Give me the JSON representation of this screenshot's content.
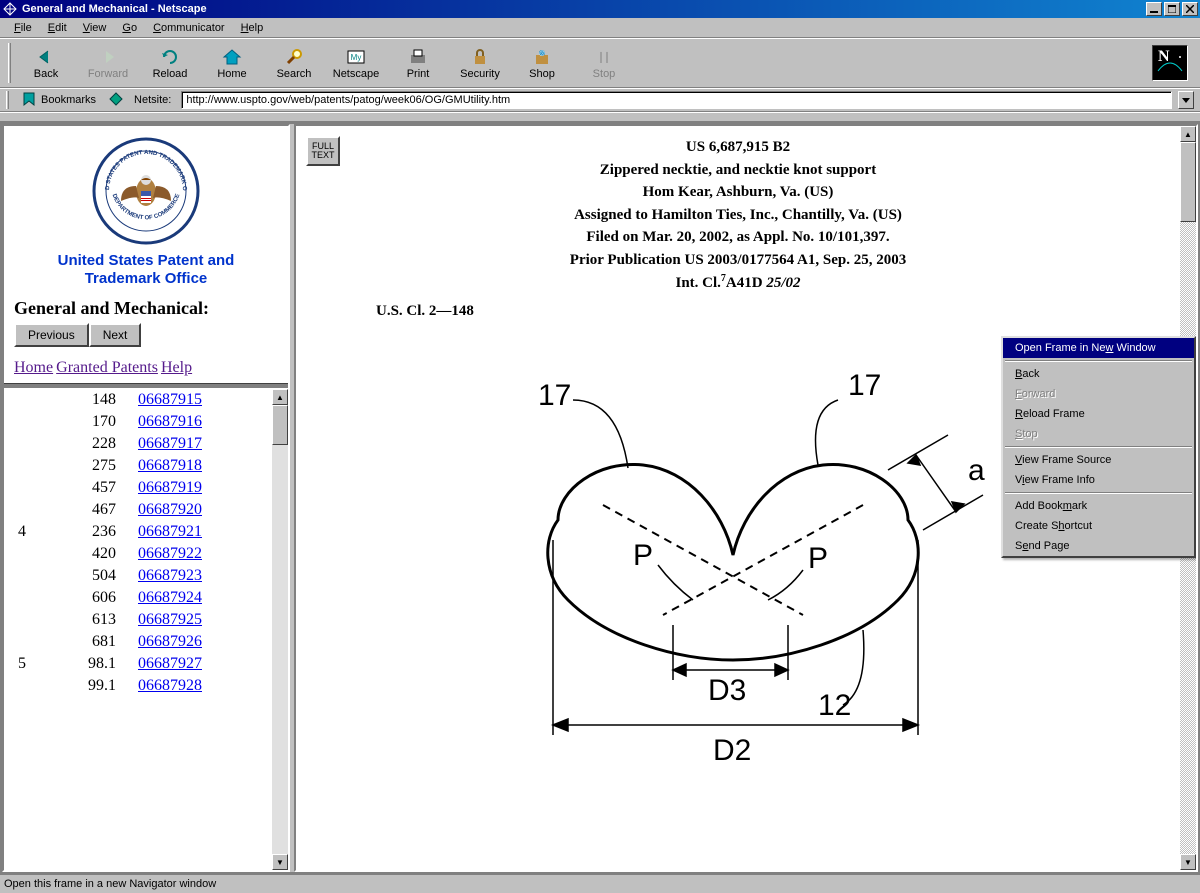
{
  "window": {
    "title": "General and Mechanical - Netscape"
  },
  "menus": {
    "file": "File",
    "edit": "Edit",
    "view": "View",
    "go": "Go",
    "communicator": "Communicator",
    "help": "Help"
  },
  "toolbar": {
    "back": "Back",
    "forward": "Forward",
    "reload": "Reload",
    "home": "Home",
    "search": "Search",
    "netscape": "Netscape",
    "print": "Print",
    "security": "Security",
    "shop": "Shop",
    "stop": "Stop"
  },
  "location": {
    "bookmarks": "Bookmarks",
    "netsite_label": "Netsite:",
    "url": "http://www.uspto.gov/web/patents/patog/week06/OG/GMUtility.htm"
  },
  "left": {
    "office_line1": "United States Patent and",
    "office_line2": "Trademark Office",
    "section_title": "General and Mechanical:",
    "prev": "Previous",
    "next": "Next",
    "links": {
      "home": "Home",
      "granted": "Granted Patents",
      "help": "Help"
    },
    "rows": [
      {
        "c1": "",
        "c2": "148",
        "c3": "06687915"
      },
      {
        "c1": "",
        "c2": "170",
        "c3": "06687916"
      },
      {
        "c1": "",
        "c2": "228",
        "c3": "06687917"
      },
      {
        "c1": "",
        "c2": "275",
        "c3": "06687918"
      },
      {
        "c1": "",
        "c2": "457",
        "c3": "06687919"
      },
      {
        "c1": "",
        "c2": "467",
        "c3": "06687920"
      },
      {
        "c1": "4",
        "c2": "236",
        "c3": "06687921"
      },
      {
        "c1": "",
        "c2": "420",
        "c3": "06687922"
      },
      {
        "c1": "",
        "c2": "504",
        "c3": "06687923"
      },
      {
        "c1": "",
        "c2": "606",
        "c3": "06687924"
      },
      {
        "c1": "",
        "c2": "613",
        "c3": "06687925"
      },
      {
        "c1": "",
        "c2": "681",
        "c3": "06687926"
      },
      {
        "c1": "5",
        "c2": "98.1",
        "c3": "06687927"
      },
      {
        "c1": "",
        "c2": "99.1",
        "c3": "06687928"
      }
    ]
  },
  "patent": {
    "full_text": "FULL\nTEXT",
    "number": "US 6,687,915 B2",
    "title": "Zippered necktie, and necktie knot support",
    "inventor": "Hom Kear, Ashburn, Va. (US)",
    "assignee": "Assigned to Hamilton Ties, Inc., Chantilly, Va. (US)",
    "filed": "Filed on Mar. 20, 2002, as Appl. No. 10/101,397.",
    "prior": "Prior Publication US 2003/0177564 A1, Sep. 25, 2003",
    "intcl_prefix": "Int. Cl.",
    "intcl_sup": "7",
    "intcl_code": "A41D",
    "intcl_subcode": "25/02",
    "uscl": "U.S. Cl. 2—148"
  },
  "diagram": {
    "seventeen_left": "17",
    "seventeen_right": "17",
    "p_left": "P",
    "p_right": "P",
    "twelve": "12",
    "a": "a",
    "d2": "D2",
    "d3": "D3"
  },
  "context_menu": {
    "open_frame": "Open Frame in New Window",
    "back": "Back",
    "forward": "Forward",
    "reload_frame": "Reload Frame",
    "stop": "Stop",
    "view_source": "View Frame Source",
    "view_info": "View Frame Info",
    "add_bookmark": "Add Bookmark",
    "create_shortcut": "Create Shortcut",
    "send_page": "Send Page"
  },
  "status": {
    "text": "Open this frame in a new Navigator window"
  }
}
